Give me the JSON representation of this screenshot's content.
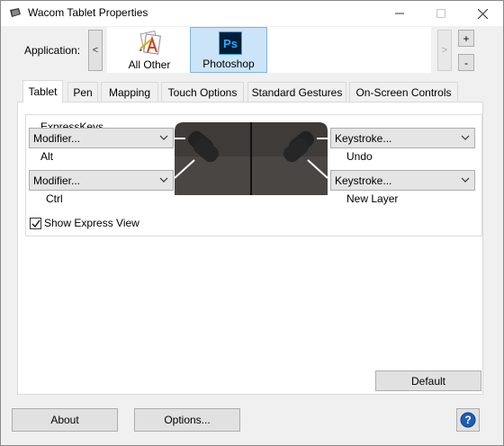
{
  "window": {
    "title": "Wacom Tablet Properties",
    "controls": {
      "minimize": "—",
      "maximize": "☐",
      "close": "✕"
    }
  },
  "application_bar": {
    "label": "Application:",
    "scroll_left": "<",
    "scroll_right": ">",
    "add": "+",
    "remove": "-",
    "apps": [
      {
        "label": "All Other",
        "icon": "all-other-apps-icon",
        "selected": false
      },
      {
        "label": "Photoshop",
        "icon": "photoshop-icon",
        "icon_text": "Ps",
        "selected": true
      }
    ]
  },
  "tabs": [
    {
      "label": "Tablet",
      "active": true
    },
    {
      "label": "Pen",
      "active": false
    },
    {
      "label": "Mapping",
      "active": false
    },
    {
      "label": "Touch Options",
      "active": false
    },
    {
      "label": "Standard Gestures",
      "active": false
    },
    {
      "label": "On-Screen Controls",
      "active": false
    }
  ],
  "expresskeys": {
    "group_title": "ExpressKeys",
    "left": [
      {
        "selected": "Modifier...",
        "value_label": "Alt"
      },
      {
        "selected": "Modifier...",
        "value_label": "Ctrl"
      }
    ],
    "right": [
      {
        "selected": "Keystroke...",
        "value_label": "Undo"
      },
      {
        "selected": "Keystroke...",
        "value_label": "New Layer"
      }
    ]
  },
  "show_express_view": {
    "label": "Show Express View",
    "checked": true
  },
  "buttons": {
    "default": "Default",
    "about": "About",
    "options": "Options...",
    "help": "?"
  },
  "colors": {
    "selected_tile_bg": "#cce4f7",
    "selected_tile_border": "#7eb4ea",
    "photoshop_blue": "#31a8ff",
    "photoshop_bg": "#001d34",
    "help_blue": "#1c5db5"
  }
}
